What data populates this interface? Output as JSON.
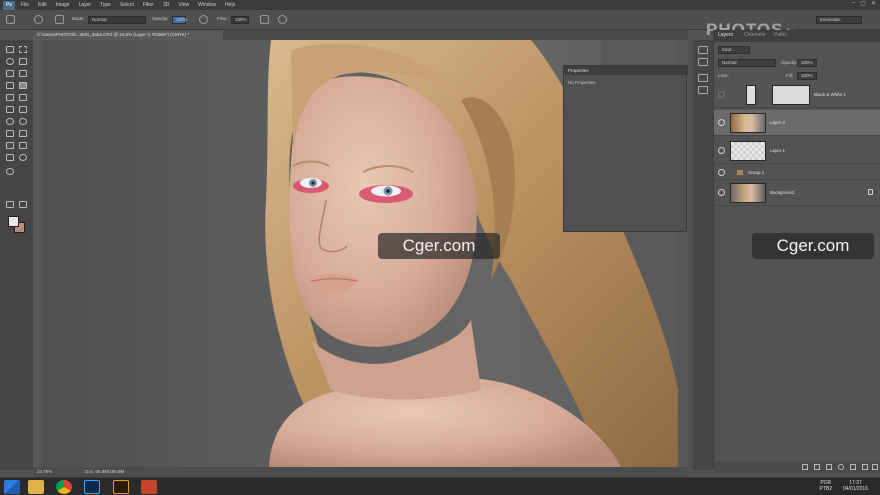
{
  "app": {
    "logo": "Ps"
  },
  "menu": [
    "File",
    "Edit",
    "Image",
    "Layer",
    "Type",
    "Select",
    "Filter",
    "3D",
    "View",
    "Window",
    "Help"
  ],
  "window_controls": [
    "–",
    "▢",
    "✕"
  ],
  "brand": {
    "main": "PHOTOS",
    "suffix": ".tv"
  },
  "options": {
    "mode_label": "Mode:",
    "mode_value": "Normal",
    "opacity_label": "Opacity:",
    "opacity_value": "100%",
    "flow_label": "Flow:",
    "flow_value": "100%",
    "workspace": "Essentials"
  },
  "document": {
    "tab_label": "C:\\Users\\PHOTOS\\...\\IMG_3454.CR2 @ 24.8% (Layer 2, RGB/8*) (CMYK) *"
  },
  "properties_panel": {
    "tab": "Properties",
    "body": "No Properties"
  },
  "layers_panel": {
    "tabs": [
      "Layers",
      "Channels",
      "Paths"
    ],
    "kind_label": "Kind",
    "blend_mode": "Normal",
    "opacity_label": "Opacity:",
    "opacity_value": "100%",
    "lock_label": "Lock:",
    "fill_label": "Fill:",
    "fill_value": "100%",
    "layers": [
      {
        "name": "Black & White 1",
        "selected": false,
        "thumb": "white"
      },
      {
        "name": "Layer 2",
        "selected": true,
        "thumb": "photo"
      },
      {
        "name": "Layer 1",
        "selected": false,
        "thumb": "transparent"
      },
      {
        "name": "Group 1",
        "selected": false,
        "thumb": "folder"
      },
      {
        "name": "Background",
        "selected": false,
        "thumb": "photo"
      }
    ]
  },
  "statusbar": {
    "zoom": "24.76%",
    "doc": "Doc: 65.9M/198.8M"
  },
  "taskbar": {
    "lang_top": "POR",
    "lang_bottom": "PTB2",
    "time": "17:37",
    "date": "04/01/2016"
  },
  "watermarks": [
    "Cger.com",
    "Cger.com"
  ],
  "icons": [
    "brush-icon",
    "move-icon",
    "marquee-icon",
    "lasso-icon",
    "crop-icon",
    "eyedropper-icon",
    "heal-icon",
    "stamp-icon",
    "eraser-icon",
    "gradient-icon",
    "pen-icon",
    "type-icon",
    "hand-icon",
    "zoom-icon",
    "eye-icon",
    "lock-icon",
    "windows-icon",
    "chrome-icon",
    "photoshop-icon",
    "bridge-icon",
    "powerpoint-icon"
  ],
  "colors": {
    "accent": "#4a6e8a",
    "foreground": "#e8e8e8",
    "background": "#b88d7d"
  }
}
